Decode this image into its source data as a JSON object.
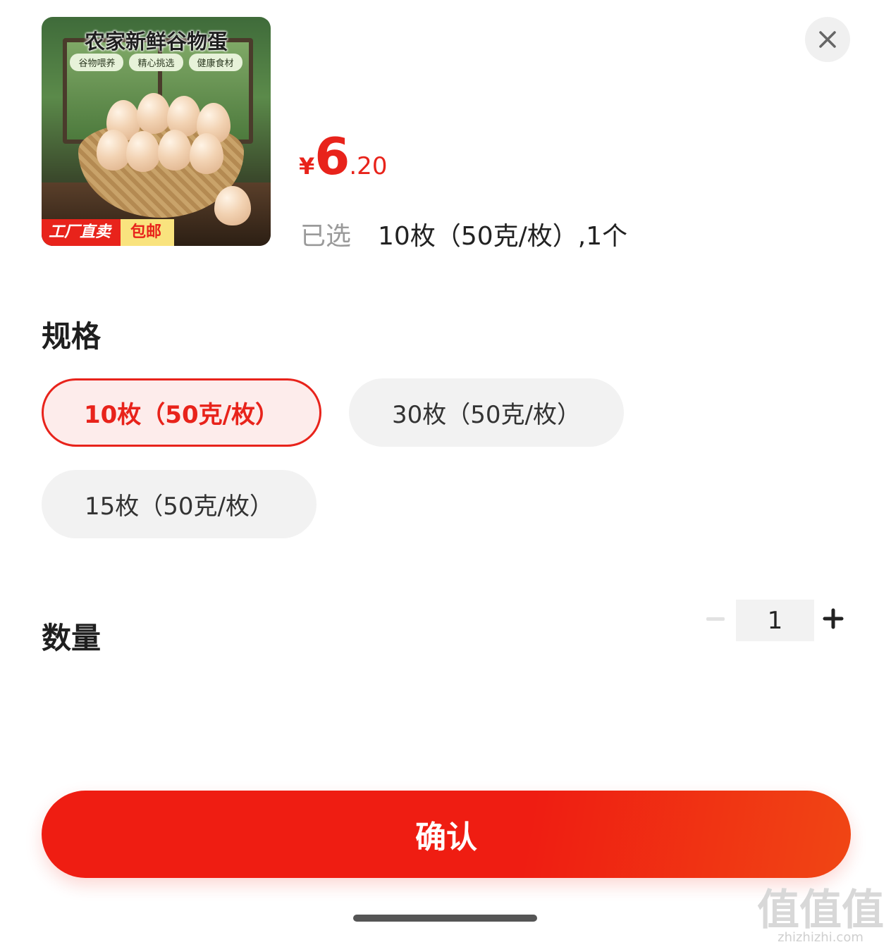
{
  "product": {
    "image_title": "农家新鲜谷物蛋",
    "image_tags": [
      "谷物喂养",
      "精心挑选",
      "健康食材"
    ],
    "badge_left": "工厂直卖",
    "badge_right": "包邮"
  },
  "price": {
    "currency": "¥",
    "integer": "6",
    "decimal": ".20"
  },
  "selected": {
    "label": "已选",
    "value": "10枚（50克/枚）,1个"
  },
  "spec": {
    "title": "规格",
    "options": [
      {
        "label": "10枚（50克/枚）",
        "active": true
      },
      {
        "label": "30枚（50克/枚）",
        "active": false
      },
      {
        "label": "15枚（50克/枚）",
        "active": false
      }
    ]
  },
  "quantity": {
    "title": "数量",
    "value": "1"
  },
  "confirm_label": "确认",
  "watermark": {
    "text": "值值值",
    "url": "zhizhizhi.com"
  },
  "colors": {
    "accent": "#e8231b",
    "active_bg": "#fdeceb",
    "pill_bg": "#f2f2f2"
  },
  "icons": {
    "close": "close-icon",
    "minus": "minus-icon",
    "plus": "plus-icon"
  }
}
